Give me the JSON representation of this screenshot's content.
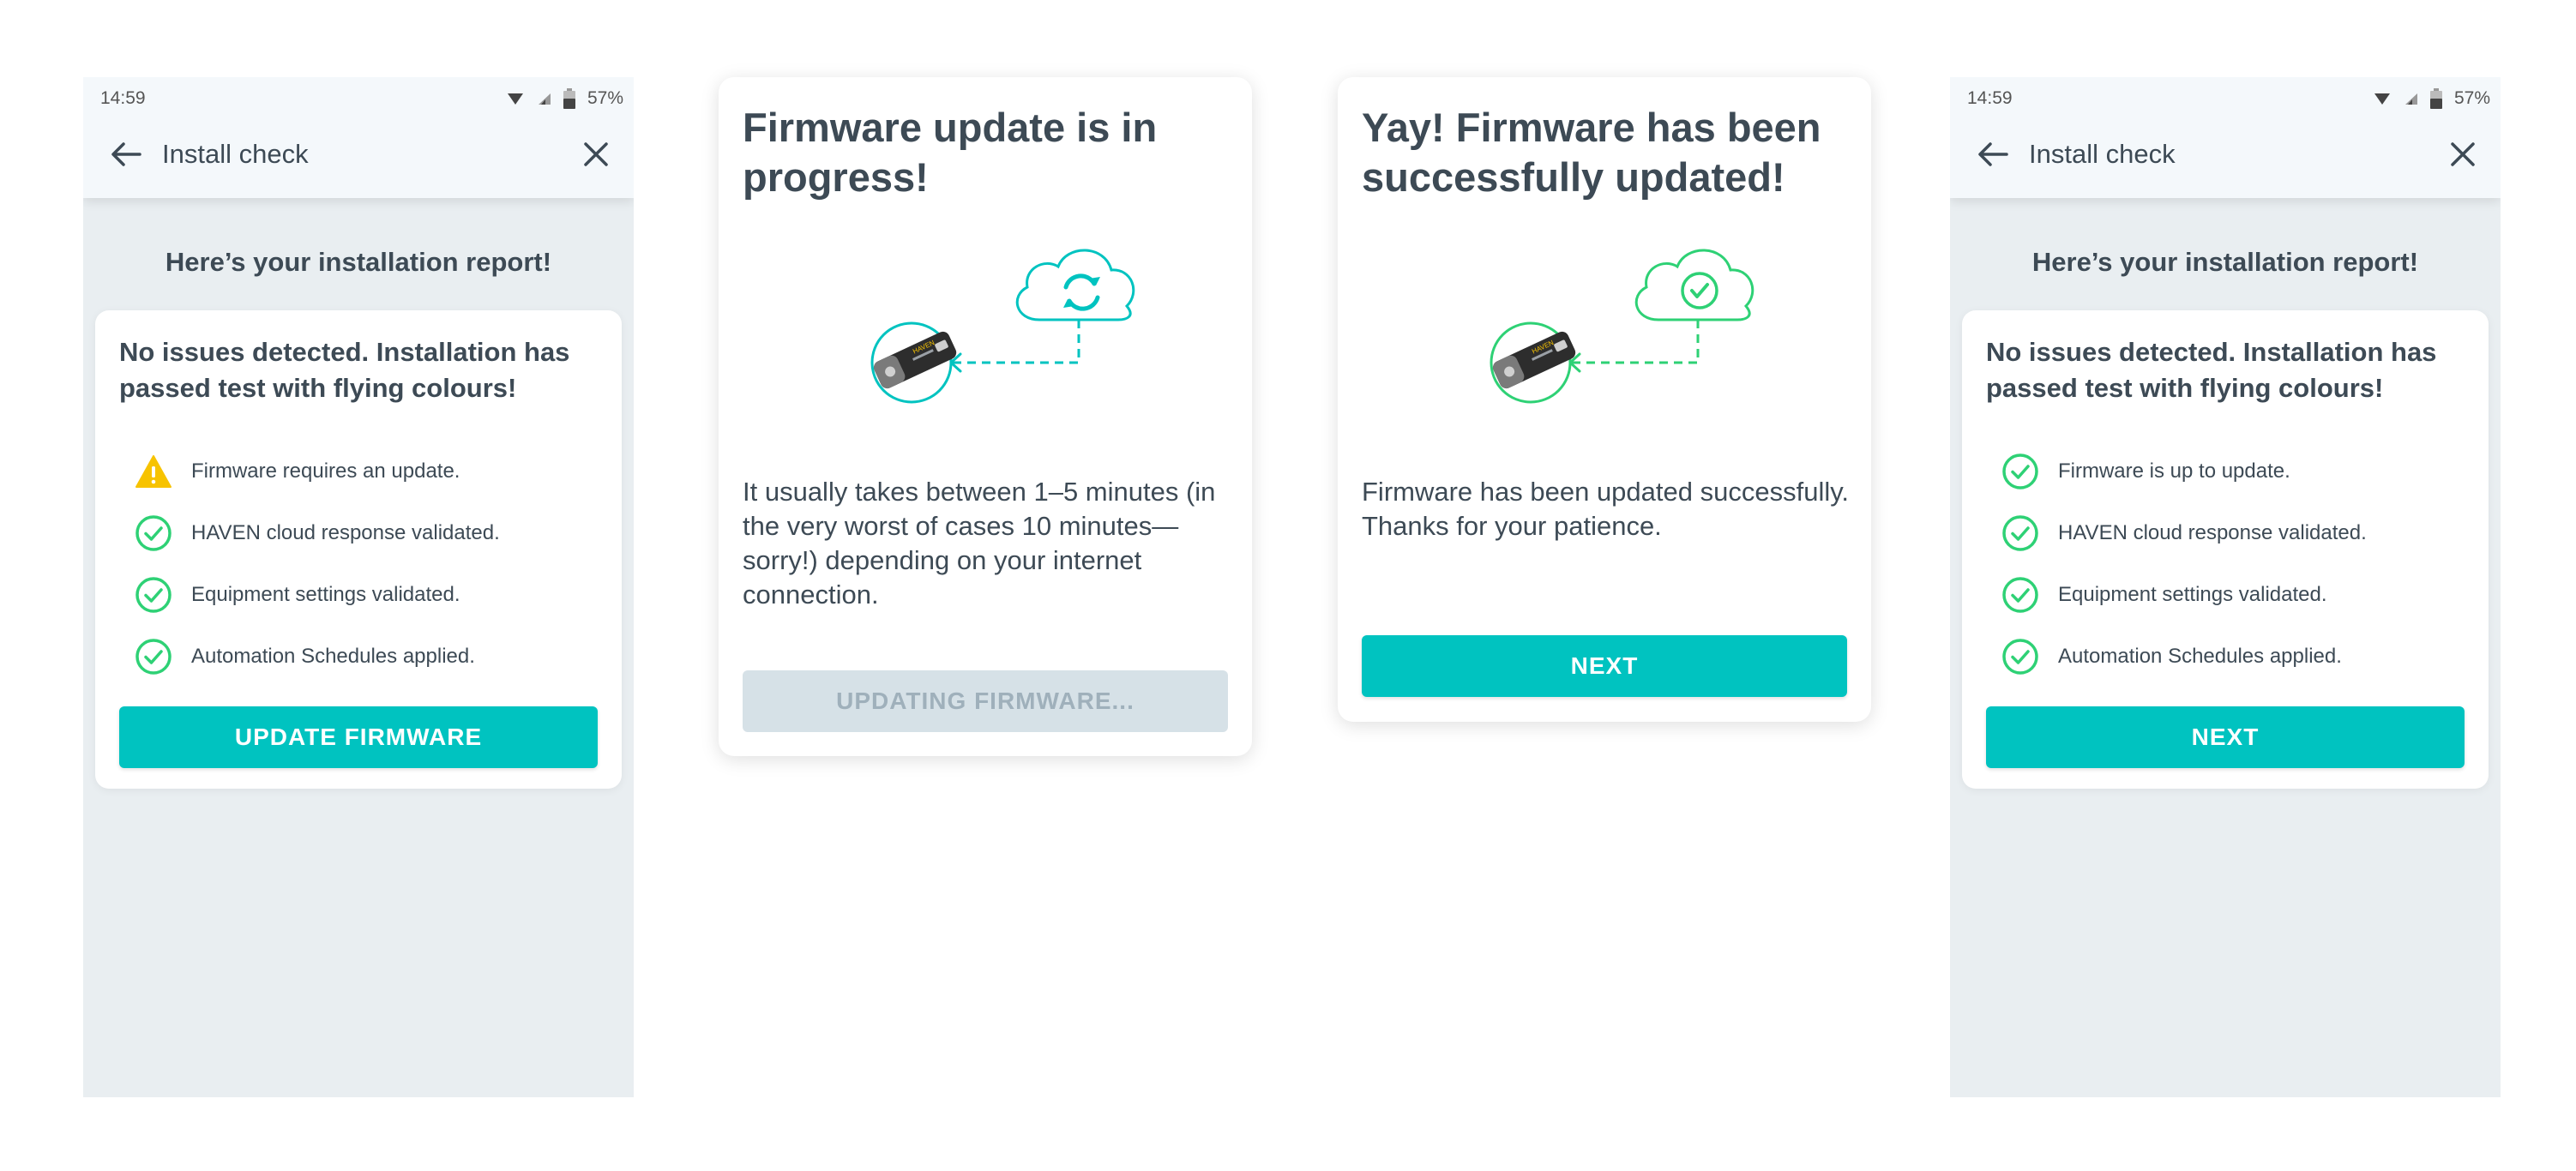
{
  "screen1": {
    "status": {
      "time": "14:59",
      "battery": "57%"
    },
    "toolbar": {
      "title": "Install check"
    },
    "heading": "Here’s your installation report!",
    "card": {
      "title": "No issues detected. Installation has passed test with flying colours!",
      "items": [
        {
          "label": "Firmware requires an update.",
          "icon": "warning-icon"
        },
        {
          "label": "HAVEN cloud response validated.",
          "icon": "check-circle-icon"
        },
        {
          "label": "Equipment settings validated.",
          "icon": "check-circle-icon"
        },
        {
          "label": "Automation Schedules applied.",
          "icon": "check-circle-icon"
        }
      ],
      "button": "UPDATE FIRMWARE"
    }
  },
  "screen2": {
    "title": "Firmware update is in progress!",
    "body": "It usually takes between 1–5 minutes (in the very worst of cases 10 minutes—sorry!) depending on your internet connection.",
    "device_label": "HAVEN",
    "button": "UPDATING FIRMWARE..."
  },
  "screen3": {
    "title": "Yay! Firmware has been successfully updated!",
    "body": "Firmware has been updated successfully. Thanks for your patience.",
    "device_label": "HAVEN",
    "button": "NEXT"
  },
  "screen4": {
    "status": {
      "time": "14:59",
      "battery": "57%"
    },
    "toolbar": {
      "title": "Install check"
    },
    "heading": "Here’s your installation report!",
    "card": {
      "title": "No issues detected. Installation has passed test with flying colours!",
      "items": [
        {
          "label": "Firmware is up to update.",
          "icon": "check-circle-icon"
        },
        {
          "label": "HAVEN cloud response validated.",
          "icon": "check-circle-icon"
        },
        {
          "label": "Equipment settings validated.",
          "icon": "check-circle-icon"
        },
        {
          "label": "Automation Schedules applied.",
          "icon": "check-circle-icon"
        }
      ],
      "button": "NEXT"
    }
  },
  "colors": {
    "accent": "#00c3c0",
    "success": "#2ed175",
    "warning": "#f7c300",
    "text": "#3d4a55",
    "disabled_bg": "#d6e1e7",
    "disabled_text": "#9fb0bb",
    "screen_bg": "#e9eef1"
  }
}
